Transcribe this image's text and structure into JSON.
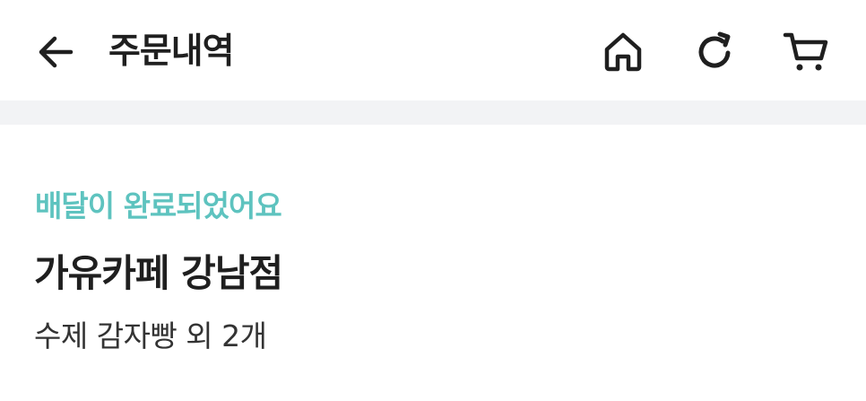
{
  "header": {
    "title": "주문내역",
    "icons": {
      "back": "arrow-left-icon",
      "home": "home-icon",
      "refresh": "refresh-icon",
      "cart": "cart-icon"
    }
  },
  "order": {
    "status": "배달이 완료되었어요",
    "store_name": "가유카페 강남점",
    "items_summary": "수제 감자빵 외 2개"
  },
  "colors": {
    "status_accent": "#5ec3bf",
    "divider": "#f2f3f5",
    "text_primary": "#1f1f1f"
  }
}
